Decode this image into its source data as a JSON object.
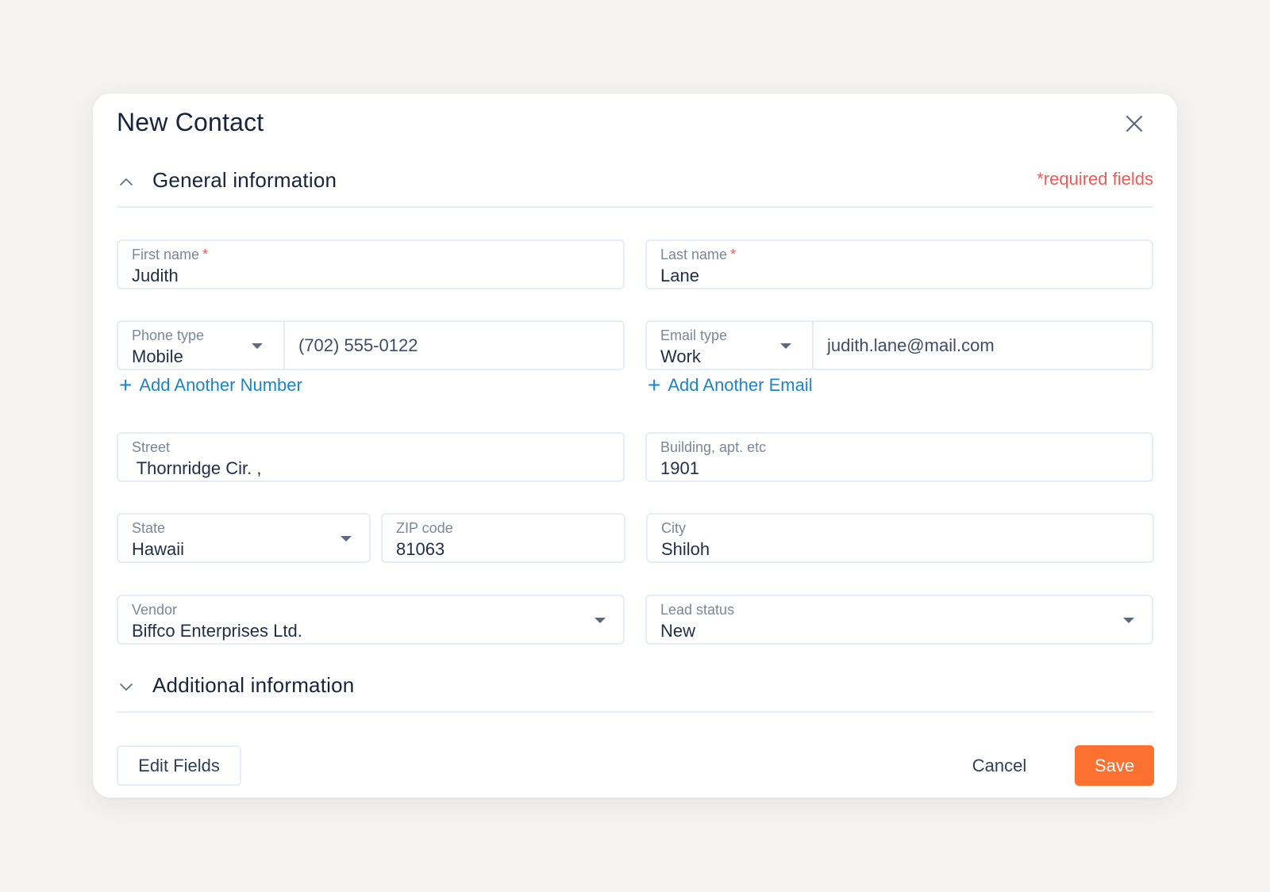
{
  "dialog": {
    "title": "New Contact",
    "close_icon": "close-icon"
  },
  "general_section": {
    "title": "General information",
    "expanded": true,
    "toggle_icon": "chevron-up-icon",
    "required_note": "*required fields"
  },
  "fields": {
    "first_name": {
      "label": "First name",
      "required_mark": "*",
      "value": "Judith"
    },
    "last_name": {
      "label": "Last name",
      "required_mark": "*",
      "value": "Lane"
    },
    "phone_type": {
      "label": "Phone type",
      "value": "Mobile"
    },
    "phone_number": {
      "value": "(702) 555-0122"
    },
    "email_type": {
      "label": "Email type",
      "value": "Work"
    },
    "email": {
      "value": "judith.lane@mail.com"
    },
    "street": {
      "label": "Street",
      "value": " Thornridge Cir. ,"
    },
    "building": {
      "label": "Building, apt. etc",
      "value": "1901"
    },
    "state": {
      "label": "State",
      "value": "Hawaii"
    },
    "zip": {
      "label": "ZIP code",
      "value": "81063"
    },
    "city": {
      "label": "City",
      "value": "Shiloh"
    },
    "vendor": {
      "label": "Vendor",
      "value": "Biffco Enterprises Ltd."
    },
    "lead_status": {
      "label": "Lead status",
      "value": "New"
    }
  },
  "links": {
    "add_number": "Add Another Number",
    "add_email": "Add Another Email",
    "plus_glyph": "+"
  },
  "additional_section": {
    "title": "Additional information",
    "expanded": false,
    "toggle_icon": "chevron-down-icon"
  },
  "footer": {
    "edit_fields": "Edit Fields",
    "cancel": "Cancel",
    "save": "Save"
  },
  "colors": {
    "accent_save": "#fd7130",
    "link": "#1a86c8",
    "required": "#f25a58",
    "background": "#f4f3f1"
  }
}
